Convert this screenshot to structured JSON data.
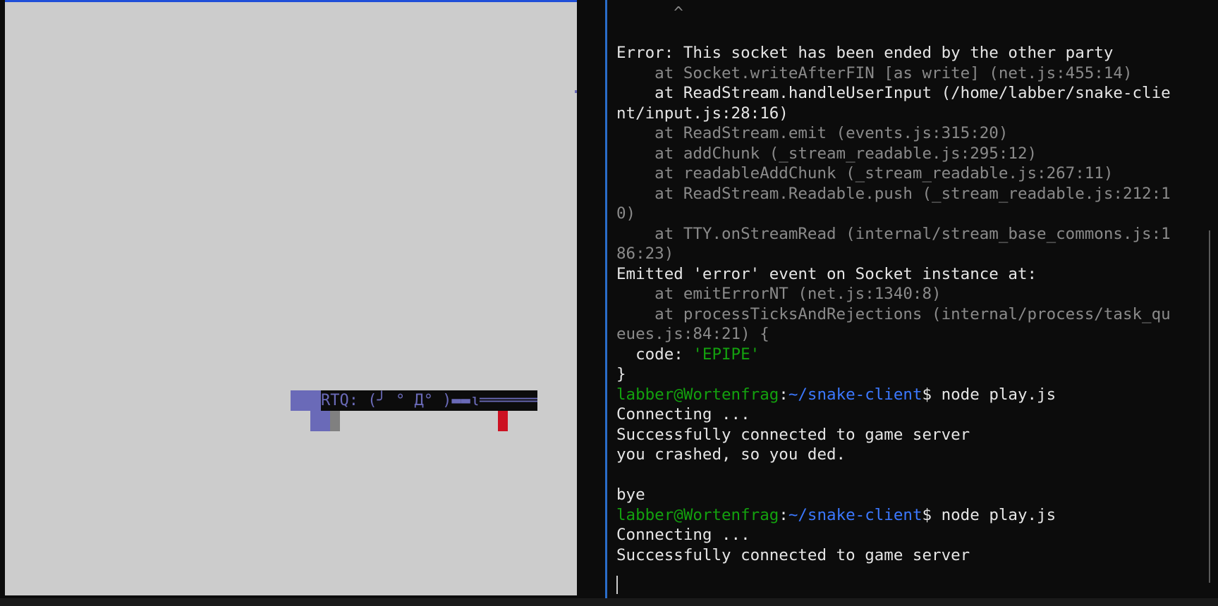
{
  "game": {
    "taunt": "RTQ: (╯ ° Д° )▬▬ι═══════",
    "colors": {
      "board": "#cccccc",
      "snake": "#6a6ab8",
      "head": "#808080",
      "food": "#cc1122",
      "topbar": "#1f4fd8"
    }
  },
  "terminal": {
    "lines": [
      {
        "segments": [
          {
            "t": "      ^",
            "c": "dim"
          }
        ]
      },
      {
        "segments": [
          {
            "t": "",
            "c": "dim"
          }
        ]
      },
      {
        "segments": [
          {
            "t": "Error: This socket has been ended by the other party",
            "c": "bright"
          }
        ]
      },
      {
        "segments": [
          {
            "t": "    at Socket.writeAfterFIN [as write] (net.js:455:14)",
            "c": "dim"
          }
        ]
      },
      {
        "segments": [
          {
            "t": "    at ReadStream.handleUserInput (/home/labber/snake-clie",
            "c": "bright"
          }
        ]
      },
      {
        "segments": [
          {
            "t": "nt/input.js:28:16)",
            "c": "bright"
          }
        ]
      },
      {
        "segments": [
          {
            "t": "    at ReadStream.emit (events.js:315:20)",
            "c": "dim"
          }
        ]
      },
      {
        "segments": [
          {
            "t": "    at addChunk (_stream_readable.js:295:12)",
            "c": "dim"
          }
        ]
      },
      {
        "segments": [
          {
            "t": "    at readableAddChunk (_stream_readable.js:267:11)",
            "c": "dim"
          }
        ]
      },
      {
        "segments": [
          {
            "t": "    at ReadStream.Readable.push (_stream_readable.js:212:1",
            "c": "dim"
          }
        ]
      },
      {
        "segments": [
          {
            "t": "0)",
            "c": "dim"
          }
        ]
      },
      {
        "segments": [
          {
            "t": "    at TTY.onStreamRead (internal/stream_base_commons.js:1",
            "c": "dim"
          }
        ]
      },
      {
        "segments": [
          {
            "t": "86:23)",
            "c": "dim"
          }
        ]
      },
      {
        "segments": [
          {
            "t": "Emitted 'error' event on Socket instance at:",
            "c": "bright"
          }
        ]
      },
      {
        "segments": [
          {
            "t": "    at emitErrorNT (net.js:1340:8)",
            "c": "dim"
          }
        ]
      },
      {
        "segments": [
          {
            "t": "    at processTicksAndRejections (internal/process/task_qu",
            "c": "dim"
          }
        ]
      },
      {
        "segments": [
          {
            "t": "eues.js:84:21) {",
            "c": "dim"
          },
          {
            "t": "",
            "c": "bright"
          }
        ]
      },
      {
        "segments": [
          {
            "t": "  code: ",
            "c": "bright"
          },
          {
            "t": "'EPIPE'",
            "c": "green-str"
          }
        ]
      },
      {
        "segments": [
          {
            "t": "}",
            "c": "bright"
          }
        ]
      },
      {
        "segments": [
          {
            "t": "labber@Wortenfrag",
            "c": "green-user"
          },
          {
            "t": ":",
            "c": "bright"
          },
          {
            "t": "~/snake-client",
            "c": "blue-path"
          },
          {
            "t": "$ node play.js",
            "c": "bright"
          }
        ]
      },
      {
        "segments": [
          {
            "t": "Connecting ...",
            "c": "bright"
          }
        ]
      },
      {
        "segments": [
          {
            "t": "Successfully connected to game server",
            "c": "bright"
          }
        ]
      },
      {
        "segments": [
          {
            "t": "you crashed, so you ded.",
            "c": "bright"
          }
        ]
      },
      {
        "segments": [
          {
            "t": "",
            "c": "bright"
          }
        ]
      },
      {
        "segments": [
          {
            "t": "bye",
            "c": "bright"
          }
        ]
      },
      {
        "segments": [
          {
            "t": "labber@Wortenfrag",
            "c": "green-user"
          },
          {
            "t": ":",
            "c": "bright"
          },
          {
            "t": "~/snake-client",
            "c": "blue-path"
          },
          {
            "t": "$ node play.js",
            "c": "bright"
          }
        ]
      },
      {
        "segments": [
          {
            "t": "Connecting ...",
            "c": "bright"
          }
        ]
      },
      {
        "segments": [
          {
            "t": "Successfully connected to game server",
            "c": "bright"
          }
        ]
      }
    ]
  }
}
